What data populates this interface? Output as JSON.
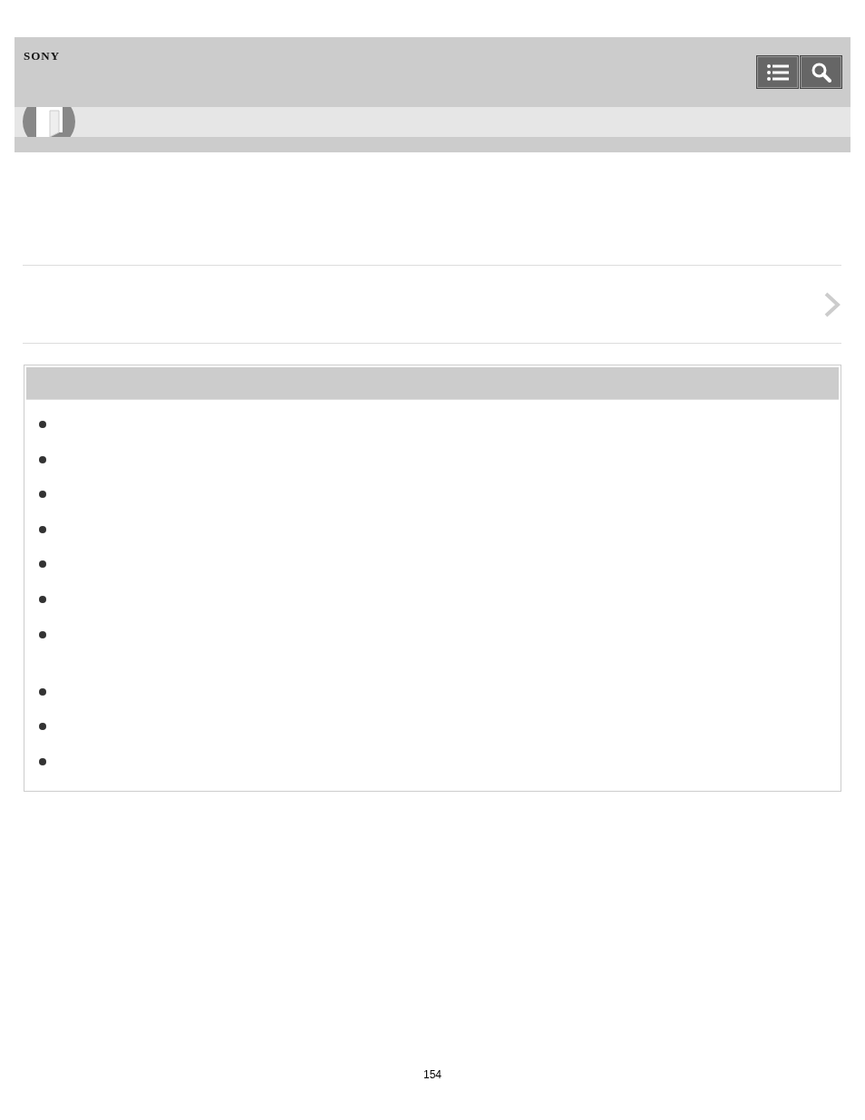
{
  "header": {
    "logo": "SONY",
    "buttons": [
      {
        "kind": "list"
      },
      {
        "kind": "search"
      }
    ]
  },
  "list": {
    "items": [
      {
        "kind": "single"
      },
      {
        "kind": "single"
      },
      {
        "kind": "single"
      },
      {
        "kind": "single"
      },
      {
        "kind": "single"
      },
      {
        "kind": "single"
      },
      {
        "kind": "double"
      },
      {
        "kind": "single"
      },
      {
        "kind": "single"
      },
      {
        "kind": "single"
      }
    ]
  },
  "page_number": "154"
}
